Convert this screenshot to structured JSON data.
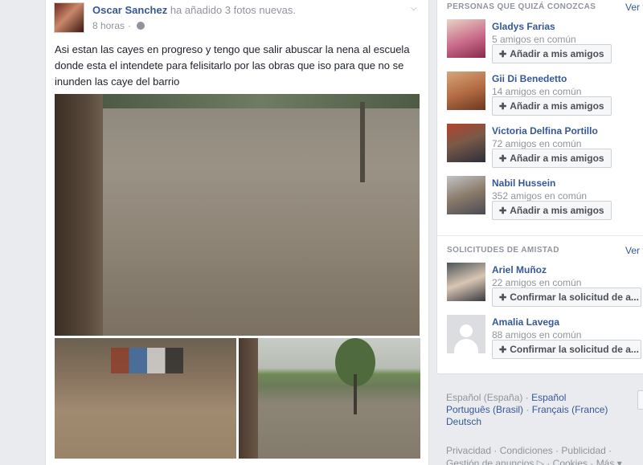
{
  "post": {
    "author_name": "Oscar Sanchez",
    "author_action": " ha añadido 3 fotos nuevas.",
    "time": "8 horas",
    "separator": " · ",
    "text": "Asi estan las cayes en progreso y tengo que salir abuscar la nena al escuela donde esta el intendete para felisitarlo por las obras que iso para que no se inunden las caye del barrio",
    "icons": {
      "privacy": "globe-icon",
      "options": "chevron-down-icon"
    }
  },
  "suggestions": {
    "title": "PERSONAS QUE QUIZÁ CONOZCAS",
    "see_all": "Ver t",
    "items": [
      {
        "name": "Gladys Farias",
        "mutual": "5 amigos en común",
        "button": "Añadir a mis amigos"
      },
      {
        "name": "Gii Di Benedetto",
        "mutual": "14 amigos en común",
        "button": "Añadir a mis amigos"
      },
      {
        "name": "Victoria Delfina Portillo",
        "mutual": "72 amigos en común",
        "button": "Añadir a mis amigos"
      },
      {
        "name": "Nabil Hussein",
        "mutual": "352 amigos en común",
        "button": "Añadir a mis amigos"
      }
    ]
  },
  "requests": {
    "title": "SOLICITUDES DE AMISTAD",
    "see_all": "Ver t",
    "items": [
      {
        "name": "Ariel Muñoz",
        "mutual": "22 amigos en común",
        "button": "Confirmar la solicitud de a..."
      },
      {
        "name": "Amalia Lavega",
        "mutual": "88 amigos en común",
        "button": "Confirmar la solicitud de a..."
      }
    ]
  },
  "languages": {
    "current": "Español (España)",
    "sep": " · ",
    "options": [
      "Español",
      "Português (Brasil)",
      "Français (France)",
      "Deutsch"
    ]
  },
  "footer": {
    "links": [
      "Privacidad",
      "Condiciones",
      "Publicidad",
      "Gestión de anuncios",
      "Cookies",
      "Más"
    ],
    "sep": " · ",
    "more_caret": "▾"
  }
}
